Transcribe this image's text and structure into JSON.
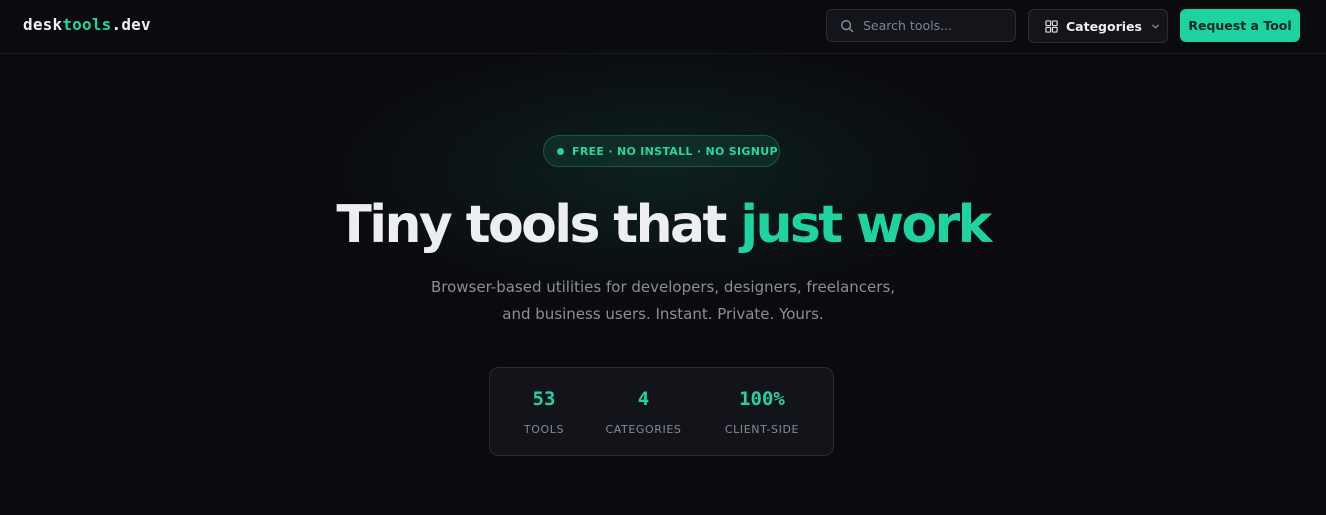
{
  "header": {
    "logo": {
      "part1": "desk",
      "part2": "tools",
      "part3": ".dev"
    },
    "search": {
      "placeholder": "Search tools...",
      "icon": "search-icon"
    },
    "categories_label": "Categories",
    "request_label": "Request a Tool"
  },
  "hero": {
    "badge": "FREE · NO INSTALL · NO SIGNUP",
    "headline_part1": "Tiny tools that ",
    "headline_part2": "just work",
    "subtitle_line1": "Browser-based utilities for developers, designers, freelancers,",
    "subtitle_line2": "and business users. Instant. Private. Yours."
  },
  "stats": [
    {
      "value": "53",
      "label": "TOOLS"
    },
    {
      "value": "4",
      "label": "CATEGORIES"
    },
    {
      "value": "100%",
      "label": "CLIENT-SIDE"
    }
  ],
  "colors": {
    "accent": "#1fd3a1",
    "background": "#0b0b0f"
  }
}
